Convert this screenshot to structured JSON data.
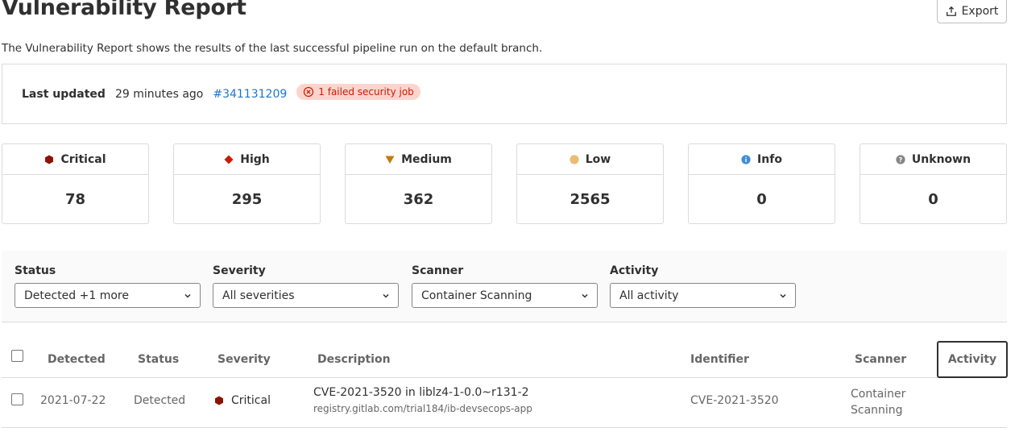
{
  "header": {
    "title": "Vulnerability Report",
    "export_label": "Export",
    "subtitle": "The Vulnerability Report shows the results of the last successful pipeline run on the default branch."
  },
  "last_updated": {
    "label": "Last updated",
    "time": "29 minutes ago",
    "pipeline_link": "#341131209",
    "failed_badge": "1 failed security job"
  },
  "severity_counts": [
    {
      "label": "Critical",
      "count": "78",
      "color": "#8d1300",
      "icon": "severity-critical-icon"
    },
    {
      "label": "High",
      "count": "295",
      "color": "#c91c00",
      "icon": "severity-high-icon"
    },
    {
      "label": "Medium",
      "count": "362",
      "color": "#c17d10",
      "icon": "severity-medium-icon"
    },
    {
      "label": "Low",
      "count": "2565",
      "color": "#e9be74",
      "icon": "severity-low-icon"
    },
    {
      "label": "Info",
      "count": "0",
      "color": "#418cd8",
      "icon": "severity-info-icon"
    },
    {
      "label": "Unknown",
      "count": "0",
      "color": "#868686",
      "icon": "severity-unknown-icon"
    }
  ],
  "filters": {
    "status": {
      "label": "Status",
      "value": "Detected +1 more"
    },
    "severity": {
      "label": "Severity",
      "value": "All severities"
    },
    "scanner": {
      "label": "Scanner",
      "value": "Container Scanning"
    },
    "activity": {
      "label": "Activity",
      "value": "All activity"
    }
  },
  "table": {
    "columns": {
      "detected": "Detected",
      "status": "Status",
      "severity": "Severity",
      "description": "Description",
      "identifier": "Identifier",
      "scanner": "Scanner",
      "activity": "Activity"
    },
    "rows": [
      {
        "detected": "2021-07-22",
        "status": "Detected",
        "severity": "Critical",
        "description": "CVE-2021-3520 in liblz4-1-0.0~r131-2",
        "location": "registry.gitlab.com/trial184/ib-devsecops-app",
        "identifier": "CVE-2021-3520",
        "scanner_line1": "Container",
        "scanner_line2": "Scanning"
      }
    ]
  },
  "colors": {
    "link": "#1f75cb",
    "danger_bg": "#fdd4cd",
    "danger_text": "#c91c00"
  }
}
